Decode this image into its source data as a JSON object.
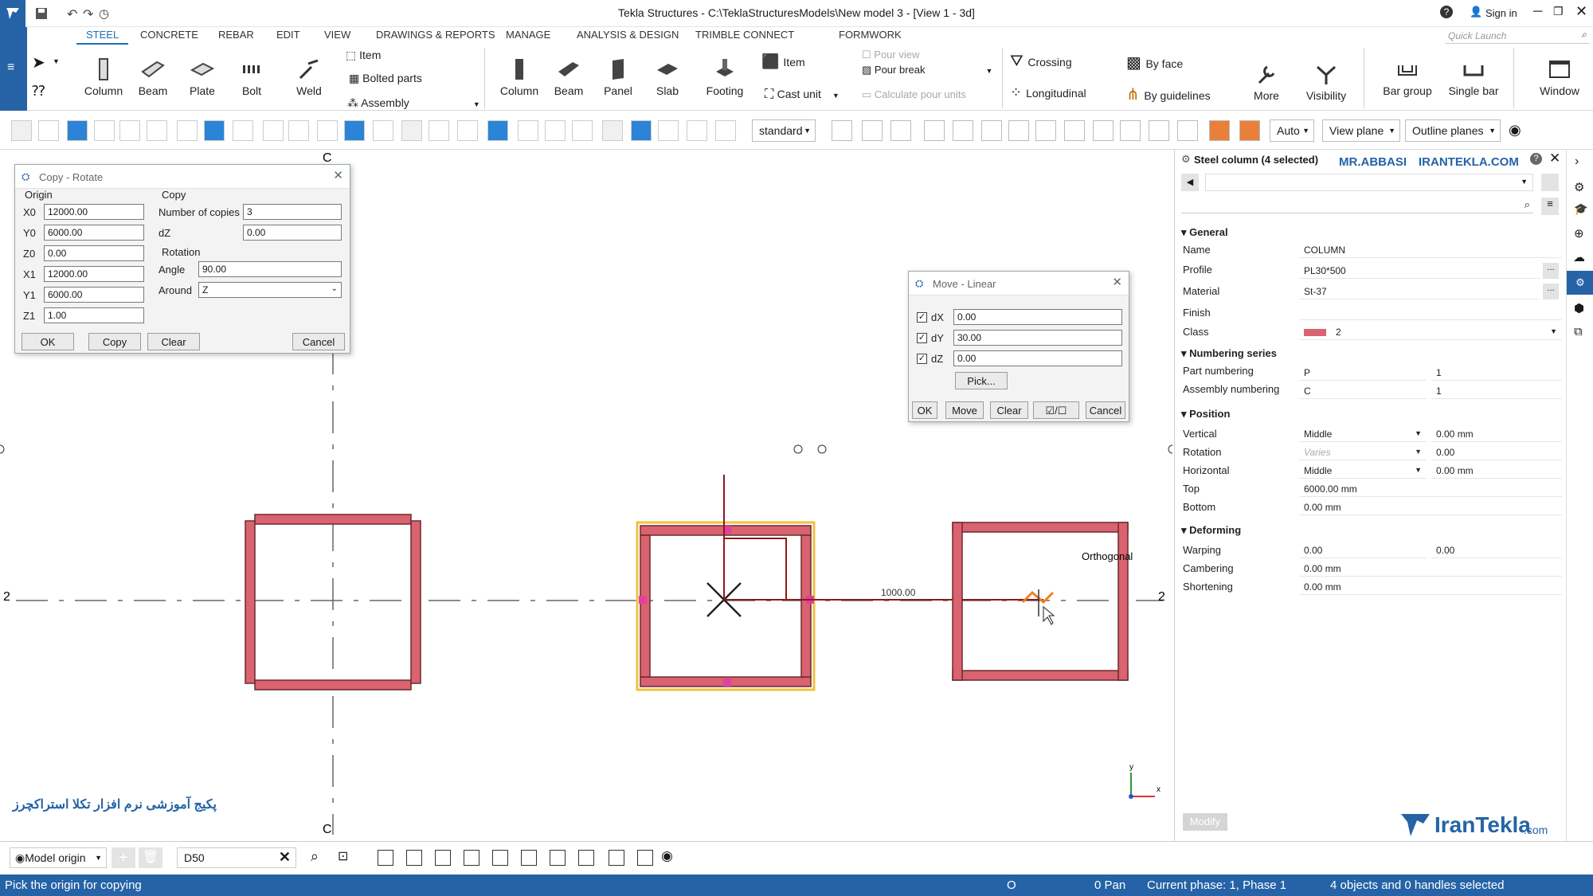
{
  "window": {
    "title": "Tekla Structures - C:\\TeklaStructuresModels\\New model 3 - [View 1 - 3d]",
    "sign_in": "Sign in",
    "quick_launch": "Quick Launch"
  },
  "menu_tabs": [
    "STEEL",
    "CONCRETE",
    "REBAR",
    "EDIT",
    "VIEW",
    "DRAWINGS & REPORTS",
    "MANAGE",
    "ANALYSIS & DESIGN",
    "TRIMBLE CONNECT",
    "FORMWORK"
  ],
  "ribbon": {
    "steel": {
      "column": "Column",
      "beam": "Beam",
      "plate": "Plate",
      "bolt": "Bolt",
      "weld": "Weld",
      "item": "Item",
      "bolted_parts": "Bolted parts",
      "assembly": "Assembly"
    },
    "concrete": {
      "column": "Column",
      "beam": "Beam",
      "panel": "Panel",
      "slab": "Slab",
      "footing": "Footing",
      "item": "Item",
      "cast_unit": "Cast unit",
      "pour_view": "Pour view",
      "pour_break": "Pour break",
      "calculate_pour_units": "Calculate pour units"
    },
    "select": {
      "crossing": "Crossing",
      "longitudinal": "Longitudinal",
      "by_face": "By face",
      "by_guidelines": "By guidelines",
      "more": "More",
      "visibility": "Visibility"
    },
    "rebar": {
      "bar_group": "Bar group",
      "single_bar": "Single bar",
      "window": "Window"
    }
  },
  "toolbar": {
    "standard": "standard",
    "auto": "Auto",
    "view_plane": "View plane",
    "outline_planes": "Outline planes"
  },
  "copy_rotate": {
    "title": "Copy - Rotate",
    "origin_header": "Origin",
    "fields": [
      {
        "label": "X0",
        "value": "12000.00"
      },
      {
        "label": "Y0",
        "value": "6000.00"
      },
      {
        "label": "Z0",
        "value": "0.00"
      },
      {
        "label": "X1",
        "value": "12000.00"
      },
      {
        "label": "Y1",
        "value": "6000.00"
      },
      {
        "label": "Z1",
        "value": "1.00"
      }
    ],
    "copy_header": "Copy",
    "number_of_copies_label": "Number of copies",
    "number_of_copies": "3",
    "dz_label": "dZ",
    "dz": "0.00",
    "rotation_header": "Rotation",
    "angle_label": "Angle",
    "angle": "90.00",
    "around_label": "Around",
    "around": "Z",
    "ok": "OK",
    "copy": "Copy",
    "clear": "Clear",
    "cancel": "Cancel"
  },
  "move_linear": {
    "title": "Move - Linear",
    "fields": [
      {
        "label": "dX",
        "value": "0.00"
      },
      {
        "label": "dY",
        "value": "30.00"
      },
      {
        "label": "dZ",
        "value": "0.00"
      }
    ],
    "pick": "Pick...",
    "ok": "OK",
    "move": "Move",
    "clear": "Clear",
    "cancel": "Cancel"
  },
  "canvas": {
    "grid_c_top": "C",
    "grid_c_bottom": "C",
    "grid_2_left": "2",
    "grid_2_right": "2",
    "dimension": "1000.00",
    "snap_label": "Orthogonal",
    "watermark_persian": "پکیج آموزشی نرم افزار تکلا استراکچرز",
    "axis_x": "x",
    "axis_y": "y",
    "column_color": "#d9636e",
    "selected_color": "#f0c040"
  },
  "properties": {
    "header": "Steel column (4 selected)",
    "brand_left": "MR.ABBASI",
    "brand_right": "IRANTEKLA.COM",
    "general": "General",
    "name_label": "Name",
    "name": "COLUMN",
    "profile_label": "Profile",
    "profile": "PL30*500",
    "material_label": "Material",
    "material": "St-37",
    "finish_label": "Finish",
    "finish": "",
    "class_label": "Class",
    "class": "2",
    "numbering": "Numbering series",
    "part_numbering_label": "Part numbering",
    "part_prefix": "P",
    "part_start": "1",
    "assembly_numbering_label": "Assembly numbering",
    "assembly_prefix": "C",
    "assembly_start": "1",
    "position": "Position",
    "vertical_label": "Vertical",
    "vertical": "Middle",
    "vertical_offset": "0.00 mm",
    "rotation_label": "Rotation",
    "rotation": "Varies",
    "rotation_offset": "0.00",
    "horizontal_label": "Horizontal",
    "horizontal": "Middle",
    "horizontal_offset": "0.00 mm",
    "top_label": "Top",
    "top": "6000.00 mm",
    "bottom_label": "Bottom",
    "bottom": "0.00 mm",
    "deforming": "Deforming",
    "warping_label": "Warping",
    "warping_1": "0.00",
    "warping_2": "0.00",
    "cambering_label": "Cambering",
    "cambering": "0.00 mm",
    "shortening_label": "Shortening",
    "shortening": "0.00 mm",
    "modify": "Modify",
    "logo_main": "IranTekla",
    "logo_suffix": ".com"
  },
  "bottom": {
    "model_origin": "Model origin",
    "command": "D50"
  },
  "status": {
    "prompt": "Pick the origin for copying",
    "o": "O",
    "pan": "0 Pan",
    "phase": "Current phase: 1, Phase 1",
    "selection": "4 objects and 0 handles selected"
  }
}
